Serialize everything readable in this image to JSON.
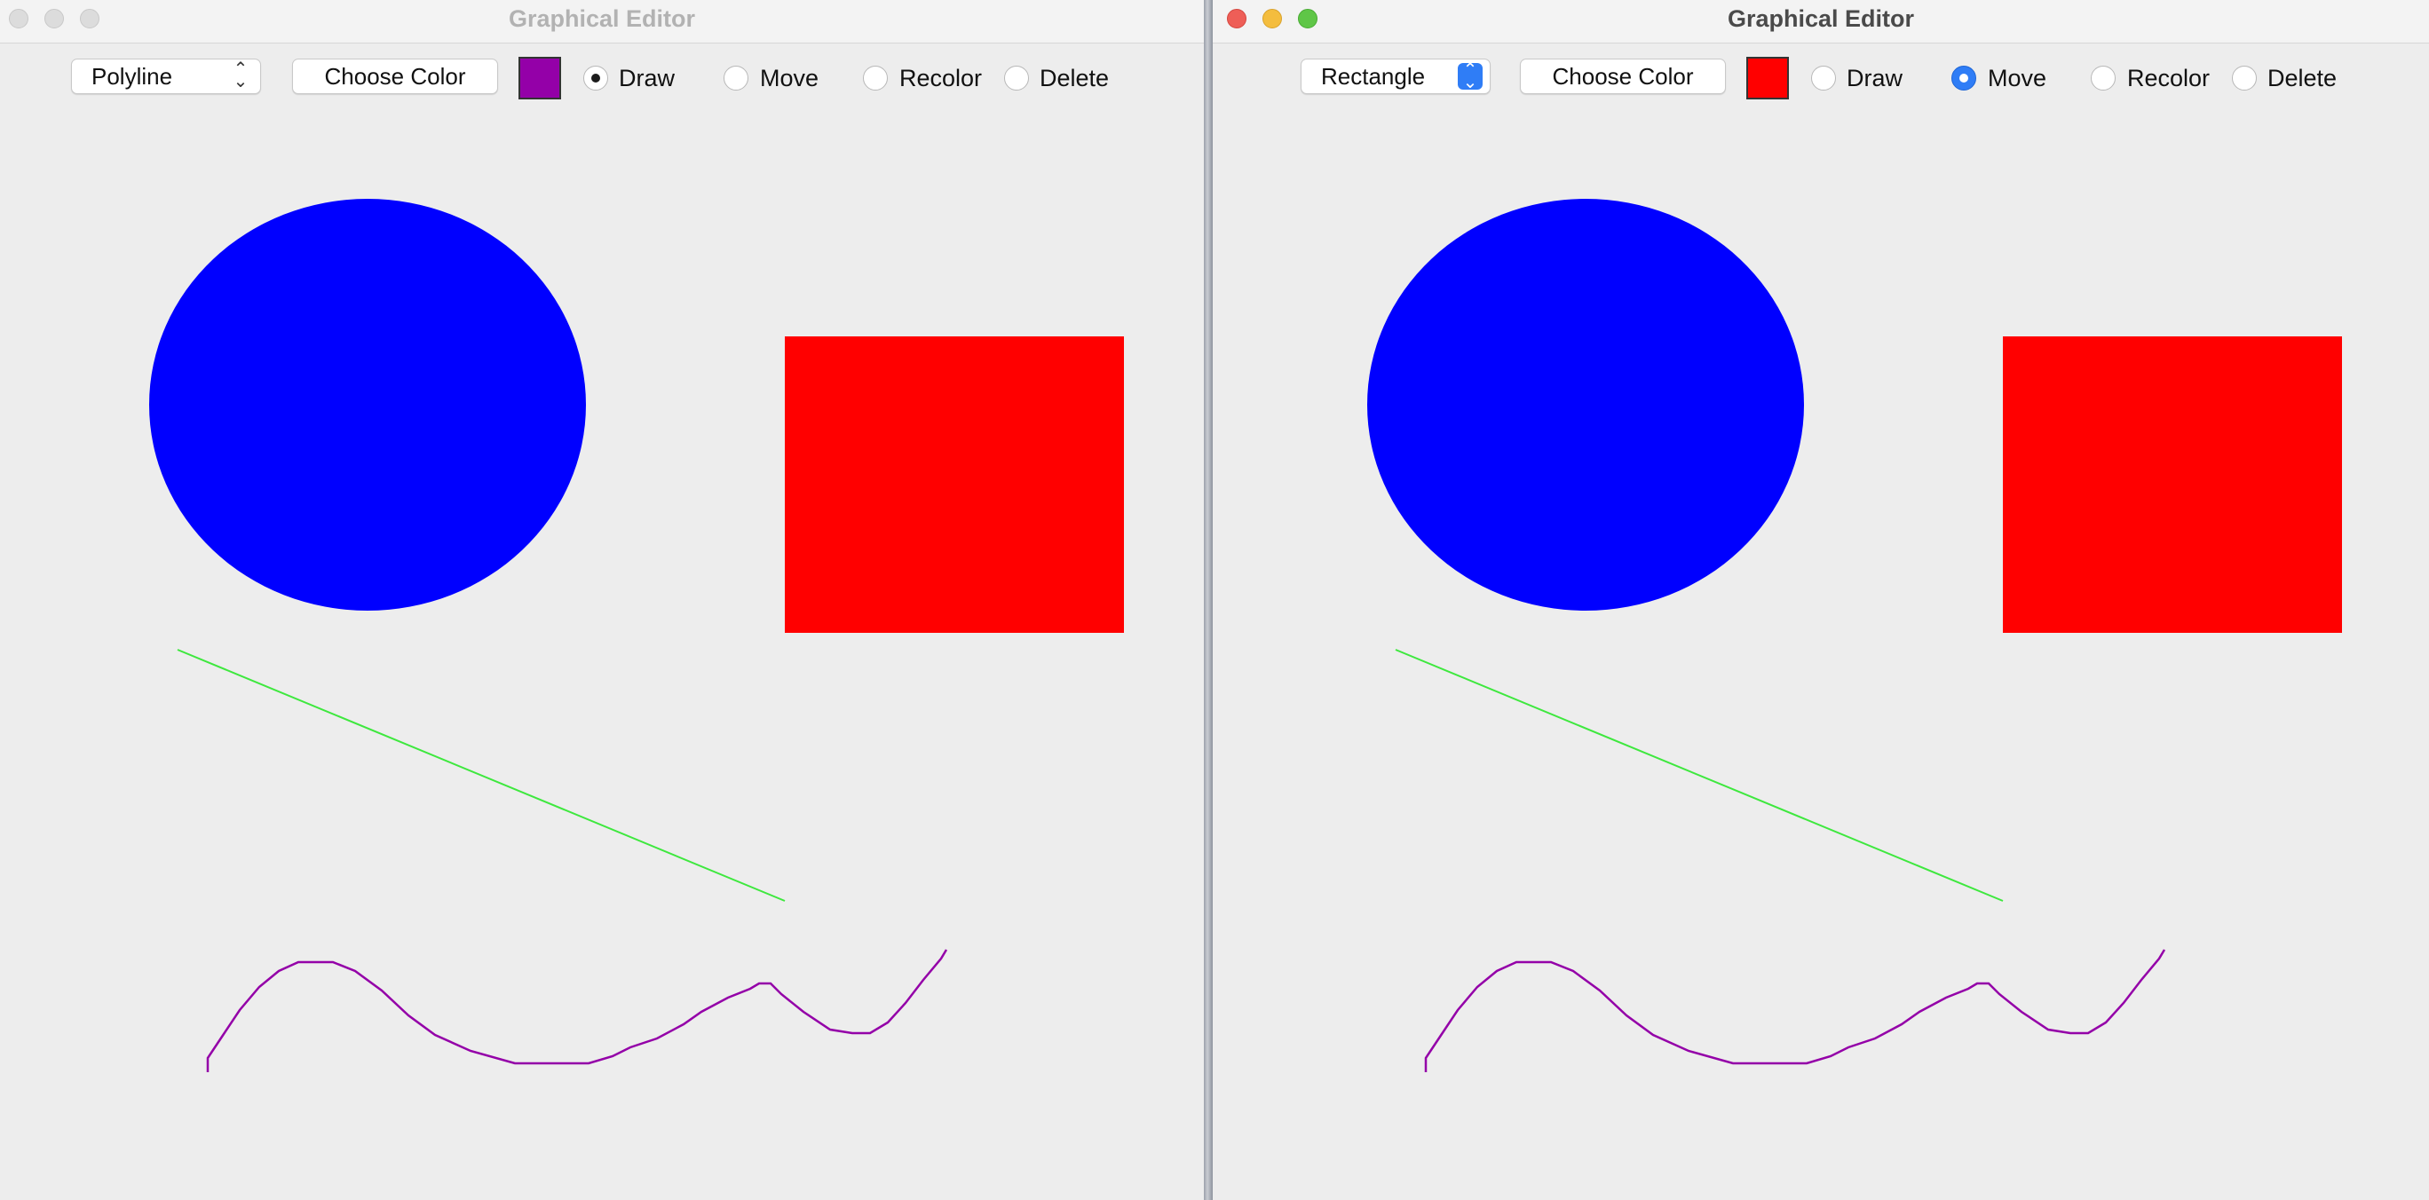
{
  "windows": [
    {
      "title": "Graphical Editor",
      "shape_select": "Polyline",
      "choose_color_label": "Choose Color",
      "current_color": "#9400a8",
      "modes": [
        "Draw",
        "Move",
        "Recolor",
        "Delete"
      ],
      "selected_mode": "Draw",
      "active": false
    },
    {
      "title": "Graphical Editor",
      "shape_select": "Rectangle",
      "choose_color_label": "Choose Color",
      "current_color": "#ff0000",
      "modes": [
        "Draw",
        "Move",
        "Recolor",
        "Delete"
      ],
      "selected_mode": "Move",
      "active": true
    }
  ],
  "shapes": {
    "ellipse_color": "#0000ff",
    "rectangle_color": "#ff0000",
    "line_color": "#3ee83e",
    "polyline_color": "#9400a8"
  }
}
